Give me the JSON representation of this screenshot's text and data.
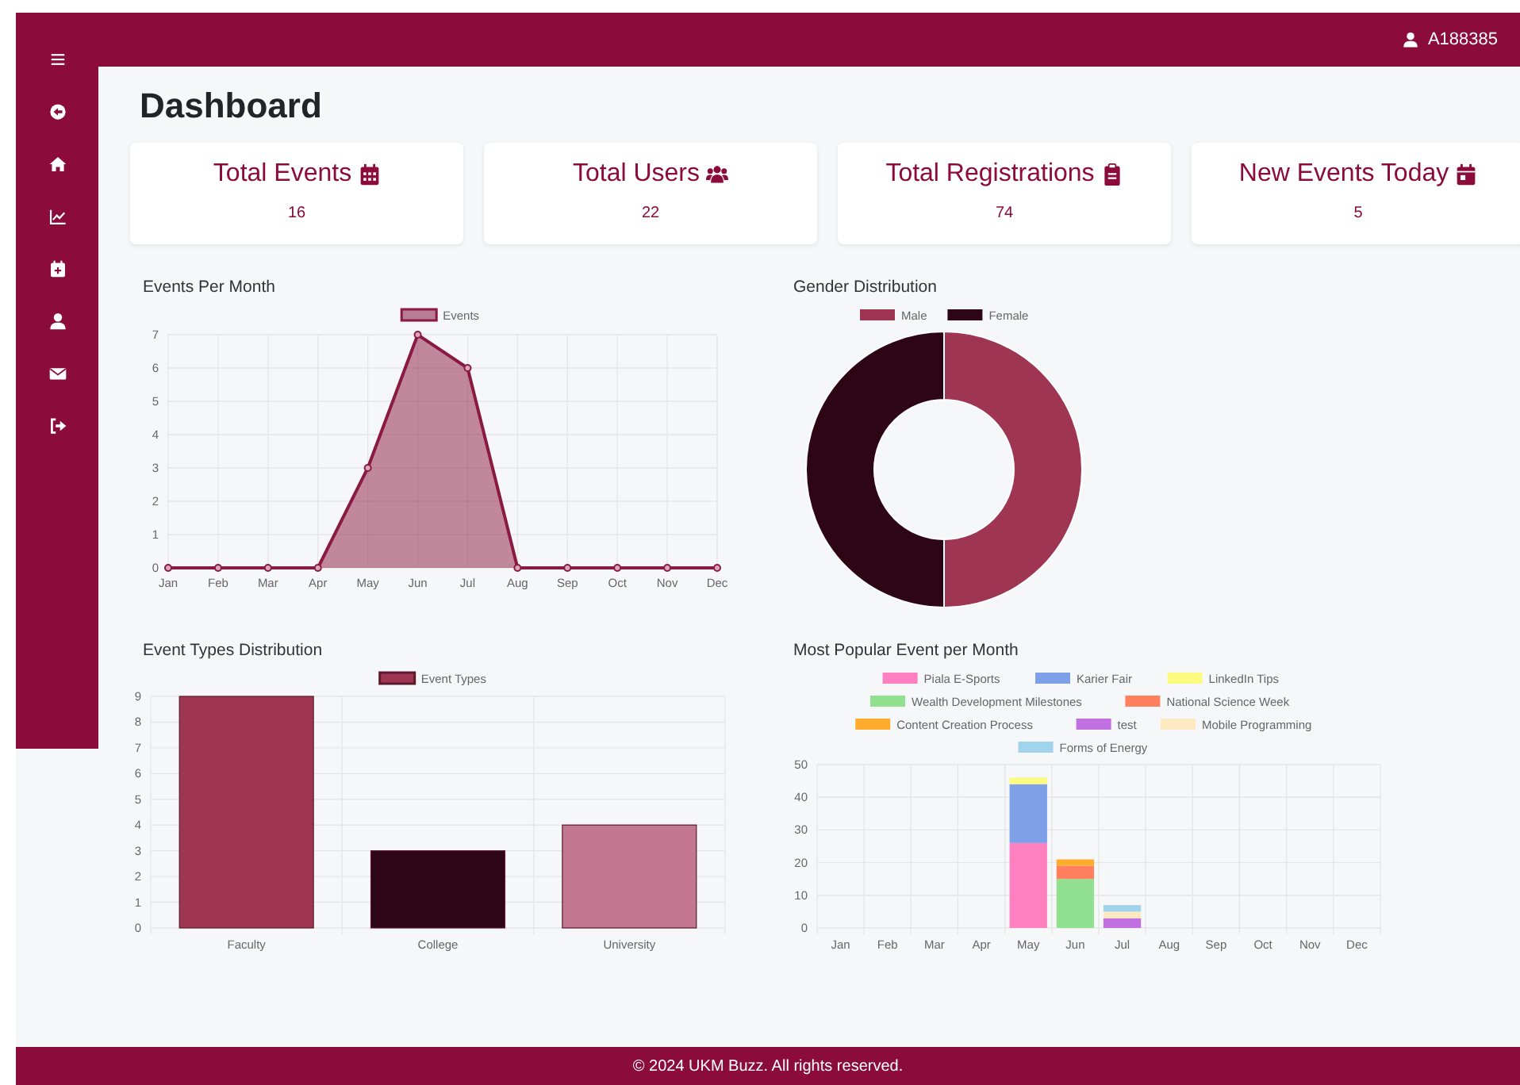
{
  "topbar": {
    "user": "A188385"
  },
  "page_title": "Dashboard",
  "stats": [
    {
      "label": "Total Events",
      "value": "16"
    },
    {
      "label": "Total Users",
      "value": "22"
    },
    {
      "label": "Total Registrations",
      "value": "74"
    },
    {
      "label": "New Events Today",
      "value": "5"
    }
  ],
  "charts": [
    {
      "title": "Events Per Month",
      "chart_data": {
        "type": "area",
        "grid": true,
        "legend": "top",
        "categories": [
          "Jan",
          "Feb",
          "Mar",
          "Apr",
          "May",
          "Jun",
          "Jul",
          "Aug",
          "Sep",
          "Oct",
          "Nov",
          "Dec"
        ],
        "ylim": [
          0,
          7
        ],
        "yticks": [
          0,
          1,
          2,
          3,
          4,
          5,
          6,
          7
        ],
        "series": [
          {
            "name": "Events",
            "color": "#8b1a40",
            "values": [
              0,
              0,
              0,
              0,
              3,
              7,
              6,
              0,
              0,
              0,
              0,
              0
            ]
          }
        ]
      }
    },
    {
      "title": "Gender Distribution",
      "chart_data": {
        "type": "donut",
        "legend": "top",
        "categories": [
          "Male",
          "Female"
        ],
        "values": [
          50,
          50
        ],
        "colors": [
          "#9e3553",
          "#2e0515"
        ]
      }
    },
    {
      "title": "Event Types Distribution",
      "chart_data": {
        "type": "bar",
        "grid": true,
        "legend": "top",
        "categories": [
          "Faculty",
          "College",
          "University"
        ],
        "ylim": [
          0,
          9
        ],
        "yticks": [
          0,
          1,
          2,
          3,
          4,
          5,
          6,
          7,
          8,
          9
        ],
        "series": [
          {
            "name": "Event Types",
            "values": [
              9,
              3,
              4
            ]
          }
        ],
        "colors": [
          "#9e3553",
          "#2e0515",
          "#c27690"
        ]
      }
    },
    {
      "title": "Most Popular Event per Month",
      "chart_data": {
        "type": "bar",
        "stacked": true,
        "grid": true,
        "legend": "top",
        "categories": [
          "Jan",
          "Feb",
          "Mar",
          "Apr",
          "May",
          "Jun",
          "Jul",
          "Aug",
          "Sep",
          "Oct",
          "Nov",
          "Dec"
        ],
        "ylim": [
          0,
          50
        ],
        "yticks": [
          0,
          10,
          20,
          30,
          40,
          50
        ],
        "series": [
          {
            "name": "Piala E-Sports",
            "color": "#ff80c0",
            "values": [
              0,
              0,
              0,
              0,
              26,
              0,
              0,
              0,
              0,
              0,
              0,
              0
            ]
          },
          {
            "name": "Karier Fair",
            "color": "#7da0e8",
            "values": [
              0,
              0,
              0,
              0,
              18,
              0,
              0,
              0,
              0,
              0,
              0,
              0
            ]
          },
          {
            "name": "LinkedIn Tips",
            "color": "#fdfa80",
            "values": [
              0,
              0,
              0,
              0,
              2,
              0,
              0,
              0,
              0,
              0,
              0,
              0
            ]
          },
          {
            "name": "Wealth Development Milestones",
            "color": "#90e090",
            "values": [
              0,
              0,
              0,
              0,
              0,
              15,
              0,
              0,
              0,
              0,
              0,
              0
            ]
          },
          {
            "name": "National Science Week",
            "color": "#ff7f5f",
            "values": [
              0,
              0,
              0,
              0,
              0,
              4,
              0,
              0,
              0,
              0,
              0,
              0
            ]
          },
          {
            "name": "Content Creation Process",
            "color": "#ffab2e",
            "values": [
              0,
              0,
              0,
              0,
              0,
              2,
              0,
              0,
              0,
              0,
              0,
              0
            ]
          },
          {
            "name": "test",
            "color": "#c070e0",
            "values": [
              0,
              0,
              0,
              0,
              0,
              0,
              3,
              0,
              0,
              0,
              0,
              0
            ]
          },
          {
            "name": "Mobile Programming",
            "color": "#fde8c0",
            "values": [
              0,
              0,
              0,
              0,
              0,
              0,
              2,
              0,
              0,
              0,
              0,
              0
            ]
          },
          {
            "name": "Forms of Energy",
            "color": "#a0d4ec",
            "values": [
              0,
              0,
              0,
              0,
              0,
              0,
              2,
              0,
              0,
              0,
              0,
              0
            ]
          }
        ]
      }
    }
  ],
  "footer": "© 2024 UKM Buzz. All rights reserved."
}
